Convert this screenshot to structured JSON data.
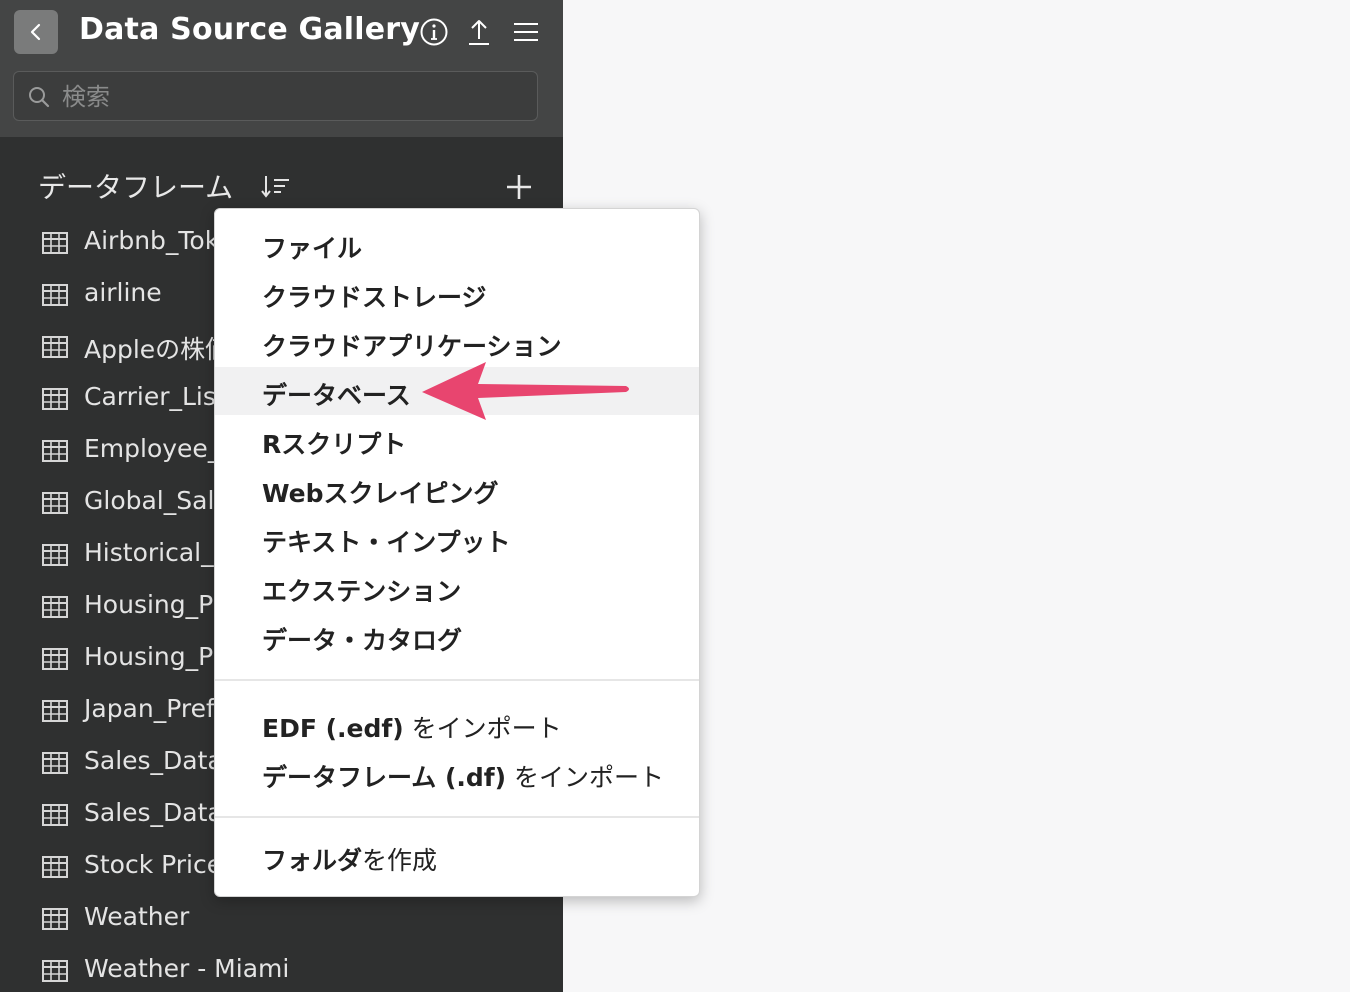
{
  "header": {
    "title": "Data Source Gallery",
    "back_icon": "chevron-left-icon",
    "info_icon": "info-icon",
    "upload_icon": "upload-icon",
    "menu_icon": "hamburger-menu-icon"
  },
  "search": {
    "placeholder": "検索",
    "value": ""
  },
  "section": {
    "title": "データフレーム",
    "sort_icon": "sort-icon",
    "add_icon": "plus-icon"
  },
  "dataframes": [
    {
      "label": "Airbnb_Tok"
    },
    {
      "label": "airline"
    },
    {
      "label": "Appleの株価"
    },
    {
      "label": "Carrier_List"
    },
    {
      "label": "Employee_"
    },
    {
      "label": "Global_Sale"
    },
    {
      "label": "Historical_S"
    },
    {
      "label": "Housing_Pr"
    },
    {
      "label": "Housing_Pr"
    },
    {
      "label": "Japan_Pref"
    },
    {
      "label": "Sales_Data"
    },
    {
      "label": "Sales_Data"
    },
    {
      "label": "Stock Price"
    },
    {
      "label": "Weather"
    },
    {
      "label": "Weather - Miami"
    }
  ],
  "menu": {
    "items": [
      {
        "label": "ファイル"
      },
      {
        "label": "クラウドストレージ"
      },
      {
        "label": "クラウドアプリケーション"
      },
      {
        "label": "データベース"
      },
      {
        "label": "Rスクリプト"
      },
      {
        "label": "Webスクレイピング"
      },
      {
        "label": "テキスト・インプット"
      },
      {
        "label": "エクステンション"
      },
      {
        "label": "データ・カタログ"
      }
    ],
    "import_items": [
      {
        "bold": "EDF (.edf)",
        "rest": " をインポート"
      },
      {
        "bold": "データフレーム (.df)",
        "rest": " をインポート"
      }
    ],
    "folder_item": {
      "bold": "フォルダ",
      "rest": "を作成"
    },
    "highlighted_index": 3
  },
  "colors": {
    "sidebar_bg": "#2f3030",
    "topbar_bg": "#444545",
    "arrow": "#e8456f",
    "highlight_bg": "#f1f1f2"
  }
}
